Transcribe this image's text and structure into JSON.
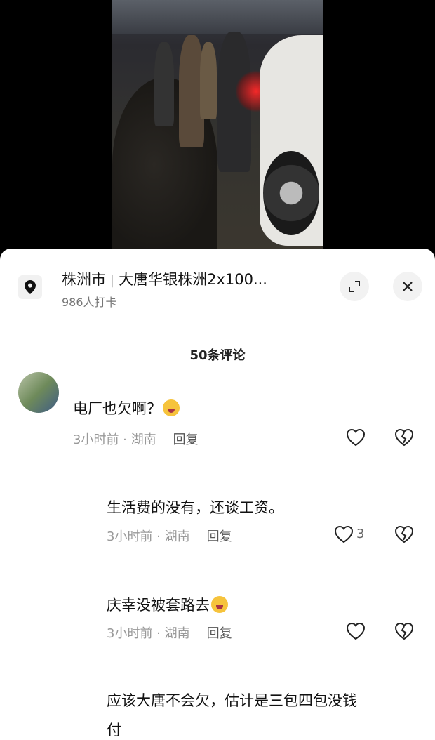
{
  "location": {
    "city": "株洲市",
    "place": "大唐华银株洲2x100...",
    "checkins": "986人打卡"
  },
  "comments_header": "50条评论",
  "comments": [
    {
      "text": "电厂也欠啊？",
      "emoji": "crying-laughing",
      "time_region": "3小时前 · 湖南",
      "reply": "回复",
      "likes": ""
    },
    {
      "text": "生活费的没有，还谈工资。",
      "emoji": "",
      "time_region": "3小时前 · 湖南",
      "reply": "回复",
      "likes": "3"
    },
    {
      "text": "庆幸没被套路去",
      "emoji": "crying-laughing",
      "time_region": "3小时前 · 湖南",
      "reply": "回复",
      "likes": ""
    },
    {
      "text_line1": "应该大唐不会欠，估计是三包四包没钱",
      "text_line2": "付"
    }
  ],
  "colors": {
    "sheet_bg": "#ffffff",
    "video_bg": "#000000",
    "meta_text": "#999999"
  }
}
